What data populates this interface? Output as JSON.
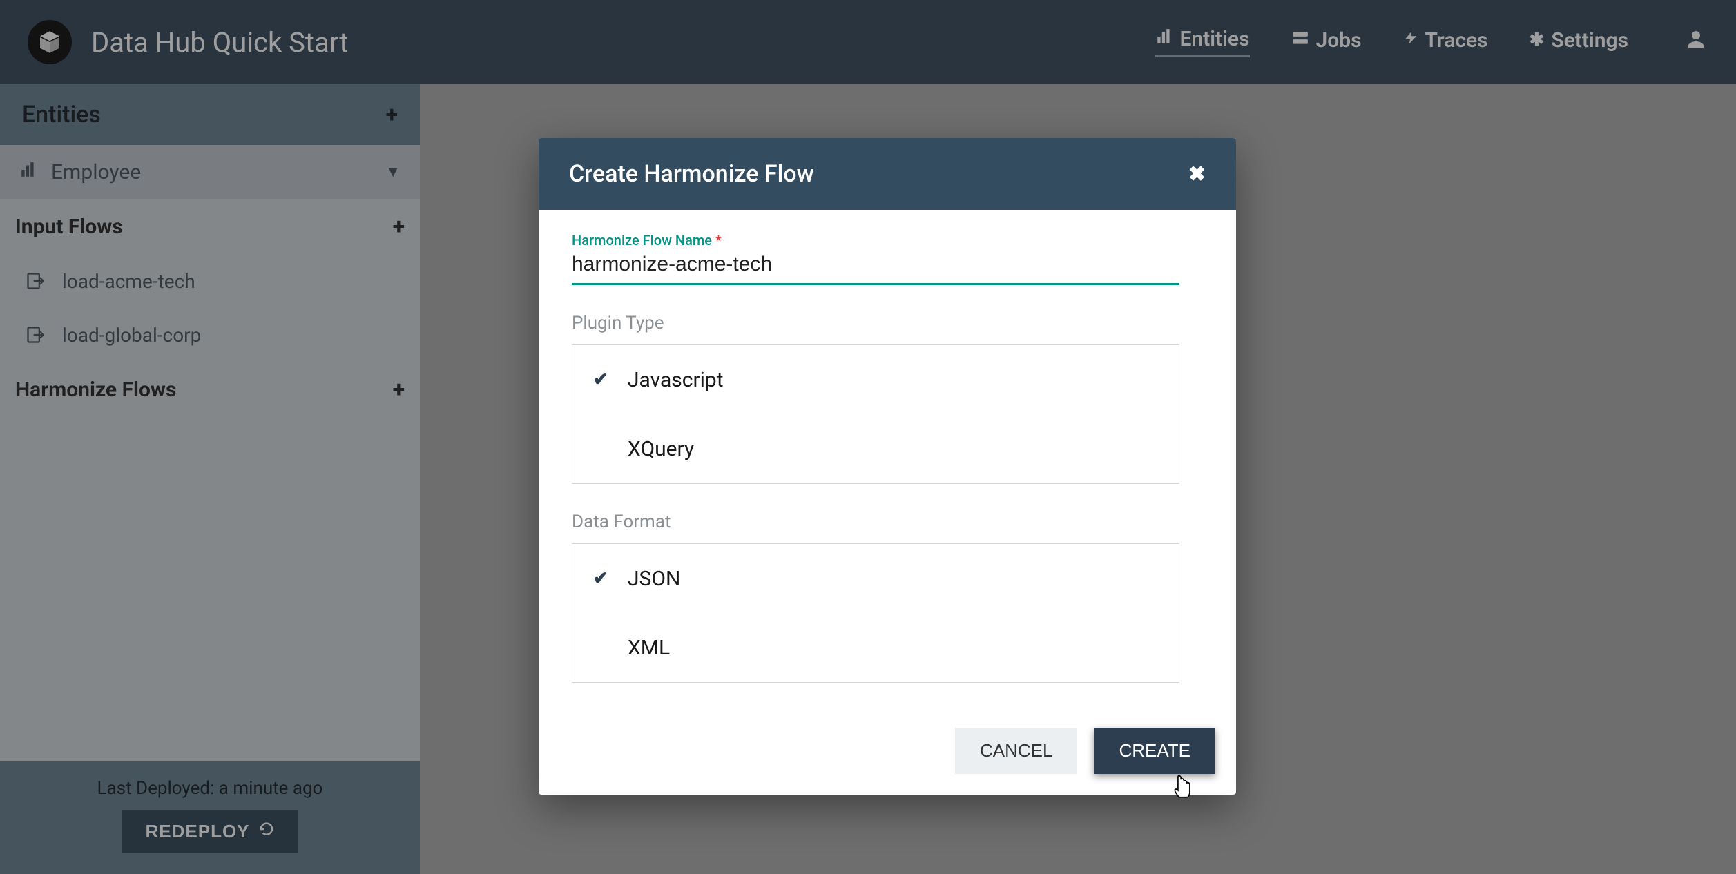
{
  "header": {
    "title": "Data Hub Quick Start",
    "nav": {
      "entities": "Entities",
      "jobs": "Jobs",
      "traces": "Traces",
      "settings": "Settings"
    }
  },
  "sidebar": {
    "entities_header": "Entities",
    "entity_selected": "Employee",
    "input_flows_header": "Input Flows",
    "input_flows": [
      {
        "label": "load-acme-tech"
      },
      {
        "label": "load-global-corp"
      }
    ],
    "harmonize_flows_header": "Harmonize Flows",
    "last_deployed": "Last Deployed: a minute ago",
    "redeploy_label": "REDEPLOY"
  },
  "modal": {
    "title": "Create Harmonize Flow",
    "flow_name_label": "Harmonize Flow Name",
    "flow_name_value": "harmonize-acme-tech",
    "plugin_type_label": "Plugin Type",
    "plugin_types": [
      {
        "label": "Javascript",
        "selected": true
      },
      {
        "label": "XQuery",
        "selected": false
      }
    ],
    "data_format_label": "Data Format",
    "data_formats": [
      {
        "label": "JSON",
        "selected": true
      },
      {
        "label": "XML",
        "selected": false
      }
    ],
    "cancel_label": "CANCEL",
    "create_label": "CREATE"
  }
}
